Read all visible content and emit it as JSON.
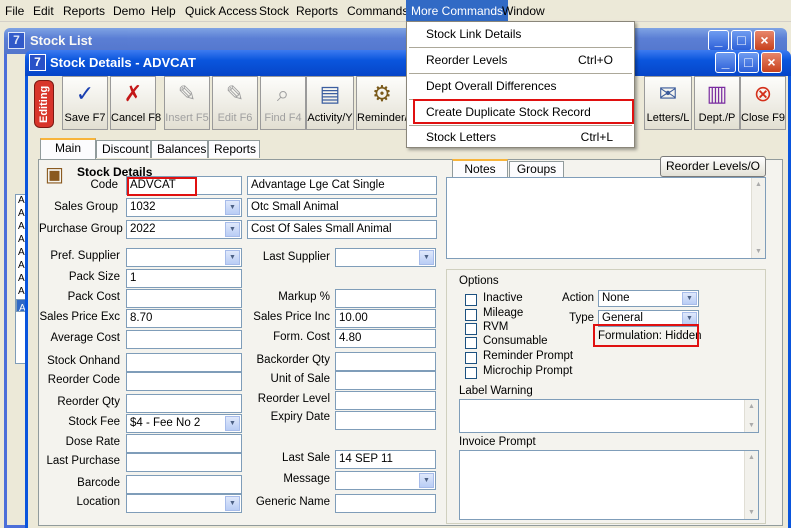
{
  "menubar": [
    "File",
    "Edit",
    "Reports",
    "Demo",
    "Help",
    "Quick Access",
    "Stock",
    "Reports",
    "Commands",
    "More Commands",
    "Window"
  ],
  "bg_window": {
    "title": "Stock List",
    "list_items": [
      "A",
      "A",
      "A",
      "A",
      "A",
      "A",
      "A",
      "A",
      "A"
    ]
  },
  "window": {
    "title": "Stock Details - ADVCAT",
    "icon": "7"
  },
  "toolbar": {
    "editing": "Editing",
    "buttons": [
      {
        "label": "Save F7",
        "icon": "✓"
      },
      {
        "label": "Cancel F8",
        "icon": "✗"
      },
      {
        "label": "Insert F5",
        "icon": "✎"
      },
      {
        "label": "Edit F6",
        "icon": "✎"
      },
      {
        "label": "Find F4",
        "icon": "⌕"
      },
      {
        "label": "Activity/Y",
        "icon": "▤"
      },
      {
        "label": "Reminder/",
        "icon": "⚙"
      },
      {
        "label": "Letters/L",
        "icon": "✉"
      },
      {
        "label": "Dept./P",
        "icon": "▥"
      },
      {
        "label": "Close F9",
        "icon": "⊗"
      }
    ]
  },
  "tabs": [
    "Main",
    "Discount",
    "Balances",
    "Reports"
  ],
  "stock_details": {
    "heading": "Stock Details",
    "code_label": "Code",
    "code": "ADVCAT",
    "description": "Advantage Lge Cat Single",
    "sales_group_label": "Sales Group",
    "sales_group": "1032",
    "sales_group_desc": "Otc Small Animal",
    "purchase_group_label": "Purchase Group",
    "purchase_group": "2022",
    "purchase_group_desc": "Cost Of Sales Small Animal"
  },
  "left_fields": {
    "pref_supplier": "Pref. Supplier",
    "pack_size": "Pack Size",
    "pack_size_value": "1",
    "pack_cost": "Pack Cost",
    "sales_price_exc": "Sales Price Exc",
    "sales_price_exc_value": "8.70",
    "average_cost": "Average Cost",
    "stock_onhand": "Stock Onhand",
    "reorder_code": "Reorder Code",
    "reorder_qty": "Reorder Qty",
    "stock_fee": "Stock Fee",
    "stock_fee_value": "$4 - Fee No 2",
    "dose_rate": "Dose Rate",
    "last_purchase": "Last Purchase",
    "barcode": "Barcode",
    "location": "Location"
  },
  "middle_fields": {
    "last_supplier": "Last Supplier",
    "markup": "Markup %",
    "sales_price_inc": "Sales Price Inc",
    "sales_price_inc_value": "10.00",
    "form_cost": "Form. Cost",
    "form_cost_value": "4.80",
    "backorder_qty": "Backorder Qty",
    "unit_of_sale": "Unit of Sale",
    "reorder_level": "Reorder Level",
    "expiry_date": "Expiry Date",
    "last_sale": "Last Sale",
    "last_sale_value": "14 SEP 11",
    "message": "Message",
    "generic_name": "Generic Name"
  },
  "right_panel": {
    "notes_tab": "Notes",
    "groups_tab": "Groups",
    "reorder_levels_button": "Reorder Levels/O",
    "options_title": "Options",
    "checkboxes": [
      "Inactive",
      "Mileage",
      "RVM",
      "Consumable",
      "Reminder Prompt",
      "Microchip Prompt"
    ],
    "action_label": "Action",
    "action_value": "None",
    "type_label": "Type",
    "type_value": "General",
    "formulation": "Formulation: Hidden",
    "label_warning": "Label Warning",
    "invoice_prompt": "Invoice Prompt"
  },
  "dropdown_menu": [
    {
      "label": "Stock Link Details",
      "shortcut": ""
    },
    {
      "label": "Reorder Levels",
      "shortcut": "Ctrl+O"
    },
    {
      "label": "Dept Overall Differences",
      "shortcut": ""
    },
    {
      "label": "Create Duplicate Stock Record",
      "shortcut": ""
    },
    {
      "label": "Stock Letters",
      "shortcut": "Ctrl+L"
    }
  ],
  "colors": {
    "menu_active": "#316AC5",
    "highlight_border": "#e01010",
    "titlebar": "#0A55DD"
  }
}
